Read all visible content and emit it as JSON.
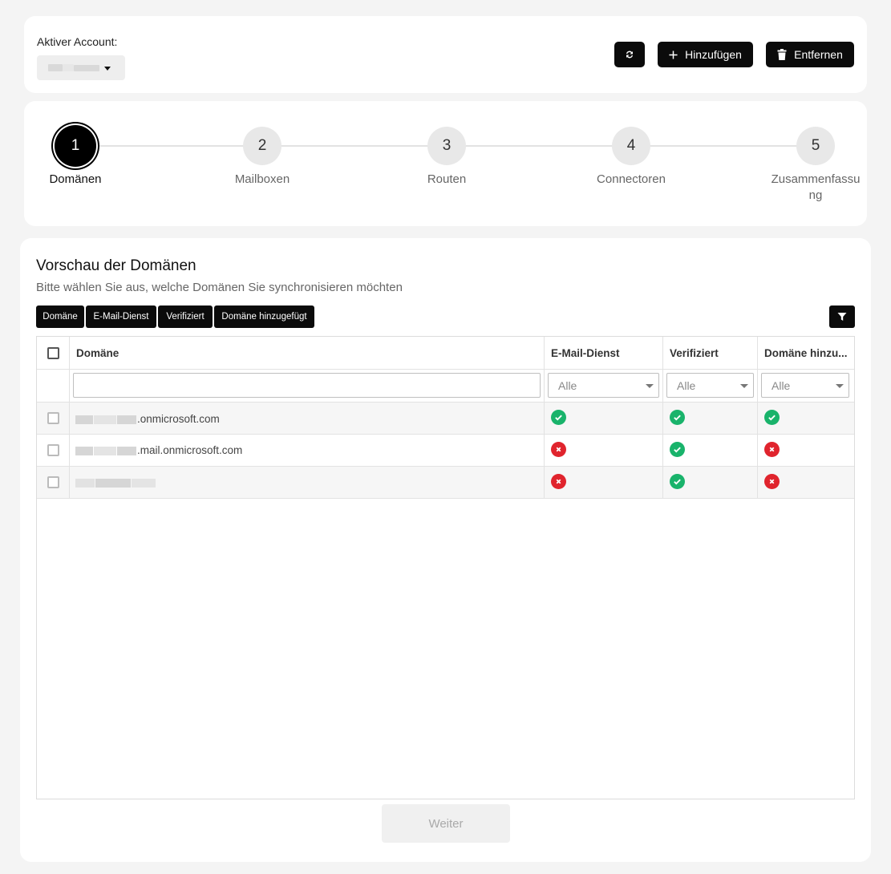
{
  "account": {
    "label": "Aktiver Account:",
    "selected_value": ""
  },
  "toolbar": {
    "refresh_icon": "refresh-icon",
    "add_label": "Hinzufügen",
    "add_icon": "plus-icon",
    "remove_label": "Entfernen",
    "remove_icon": "trash-icon"
  },
  "steps": [
    {
      "number": "1",
      "label": "Domänen",
      "active": true
    },
    {
      "number": "2",
      "label": "Mailboxen",
      "active": false
    },
    {
      "number": "3",
      "label": "Routen",
      "active": false
    },
    {
      "number": "4",
      "label": "Connectoren",
      "active": false
    },
    {
      "number": "5",
      "label": "Zusammenfassung",
      "label_lines": [
        "Zusammenfassu",
        "ng"
      ],
      "active": false
    }
  ],
  "preview": {
    "title": "Vorschau der Domänen",
    "subtitle": "Bitte wählen Sie aus, welche Domänen Sie synchronisieren möchten",
    "column_chips": [
      "Domäne",
      "E-Mail-Dienst",
      "Verifiziert",
      "Domäne hinzugefügt"
    ],
    "filter_icon": "filter-icon"
  },
  "table": {
    "headers": [
      "Domäne",
      "E-Mail-Dienst",
      "Verifiziert",
      "Domäne hinzu..."
    ],
    "filters": {
      "domain_placeholder": "",
      "email_service": "Alle",
      "verified": "Alle",
      "domain_added": "Alle"
    },
    "rows": [
      {
        "domain_suffix": ".onmicrosoft.com",
        "email_service": true,
        "verified": true,
        "domain_added": true
      },
      {
        "domain_suffix": ".mail.onmicrosoft.com",
        "email_service": false,
        "verified": true,
        "domain_added": false
      },
      {
        "domain_suffix": "",
        "email_service": false,
        "verified": true,
        "domain_added": false
      }
    ]
  },
  "next_button": {
    "label": "Weiter",
    "enabled": false
  },
  "colors": {
    "primary": "#0b0b0b",
    "success": "#19b36b",
    "error": "#e0242d",
    "background": "#f4f4f4"
  }
}
